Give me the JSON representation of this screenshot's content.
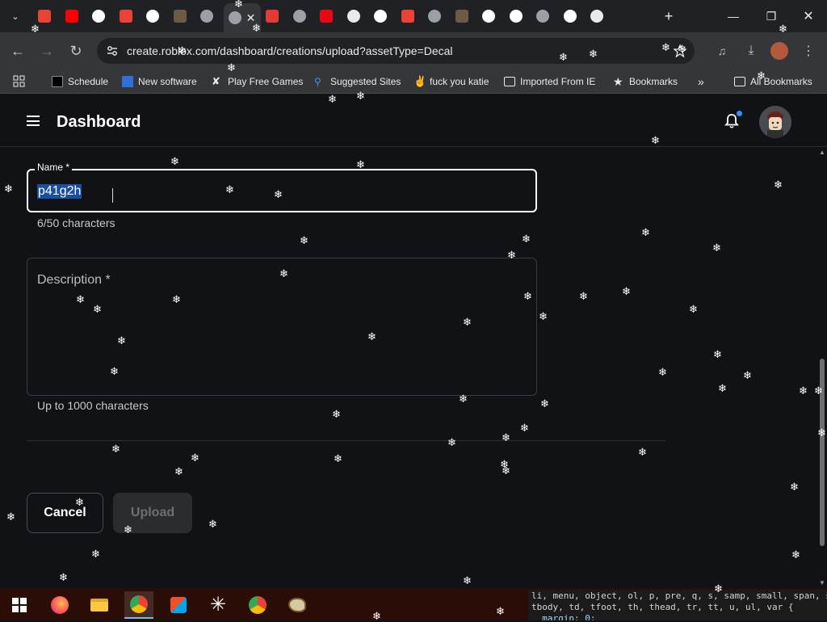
{
  "browser": {
    "tabs": [
      {
        "icon": "gmail-icon",
        "color": "#ea4335"
      },
      {
        "icon": "youtube-icon",
        "color": "#ff0000"
      },
      {
        "icon": "google-icon",
        "color": "#ffffff"
      },
      {
        "icon": "gmail-icon",
        "color": "#ea4335"
      },
      {
        "icon": "google-lens-icon",
        "color": "#ffffff"
      },
      {
        "icon": "video-thumbnail-icon",
        "color": "#6b5b45"
      },
      {
        "icon": "chrome-icon",
        "color": "#9aa0a6"
      },
      {
        "icon": "chrome-icon",
        "color": "#9aa0a6"
      },
      {
        "icon": "play-icon",
        "color": "#e53935"
      },
      {
        "icon": "globe-icon",
        "color": "#9aa0a6"
      },
      {
        "icon": "netflix-icon",
        "color": "#e50914"
      },
      {
        "icon": "download-icon",
        "color": "#e8eaed"
      },
      {
        "icon": "google-icon",
        "color": "#ffffff"
      },
      {
        "icon": "gmail-icon",
        "color": "#ea4335"
      },
      {
        "icon": "chrome-icon",
        "color": "#9aa0a6"
      },
      {
        "icon": "video-thumbnail-icon",
        "color": "#6b5b45"
      },
      {
        "icon": "google-icon",
        "color": "#ffffff"
      },
      {
        "icon": "google-icon",
        "color": "#ffffff"
      },
      {
        "icon": "globe-icon",
        "color": "#9aa0a6"
      },
      {
        "icon": "google-icon",
        "color": "#ffffff"
      },
      {
        "icon": "audio-icon",
        "color": "#e8eaed"
      }
    ],
    "url": "create.roblox.com/dashboard/creations/upload?assetType=Decal",
    "bookmarks": [
      {
        "label": "Schedule"
      },
      {
        "label": "New software"
      },
      {
        "label": "Play Free Games"
      },
      {
        "label": "Suggested Sites"
      },
      {
        "label": "fuck you katie"
      },
      {
        "label": "Imported From IE"
      },
      {
        "label": "Bookmarks"
      },
      {
        "label": "All Bookmarks"
      }
    ]
  },
  "header": {
    "title": "Dashboard"
  },
  "form": {
    "name_label": "Name *",
    "name_value": "p41g2h",
    "name_count": "6/50 characters",
    "description_label": "Description *",
    "description_hint": "Up to 1000 characters",
    "cancel_label": "Cancel",
    "upload_label": "Upload"
  },
  "devtools_snippet": {
    "line1": "li, menu, object, ol, p, pre, q, s, samp, small, span, s",
    "line2": "tbody, td, tfoot, th, thead, tr, tt, u, ul, var {",
    "line3": "  margin: 0;"
  },
  "colors": {
    "page_bg": "#111216",
    "selection": "#1a4fa0",
    "notification_dot": "#3d87ff",
    "taskbar_bg": "#2a0d06"
  }
}
